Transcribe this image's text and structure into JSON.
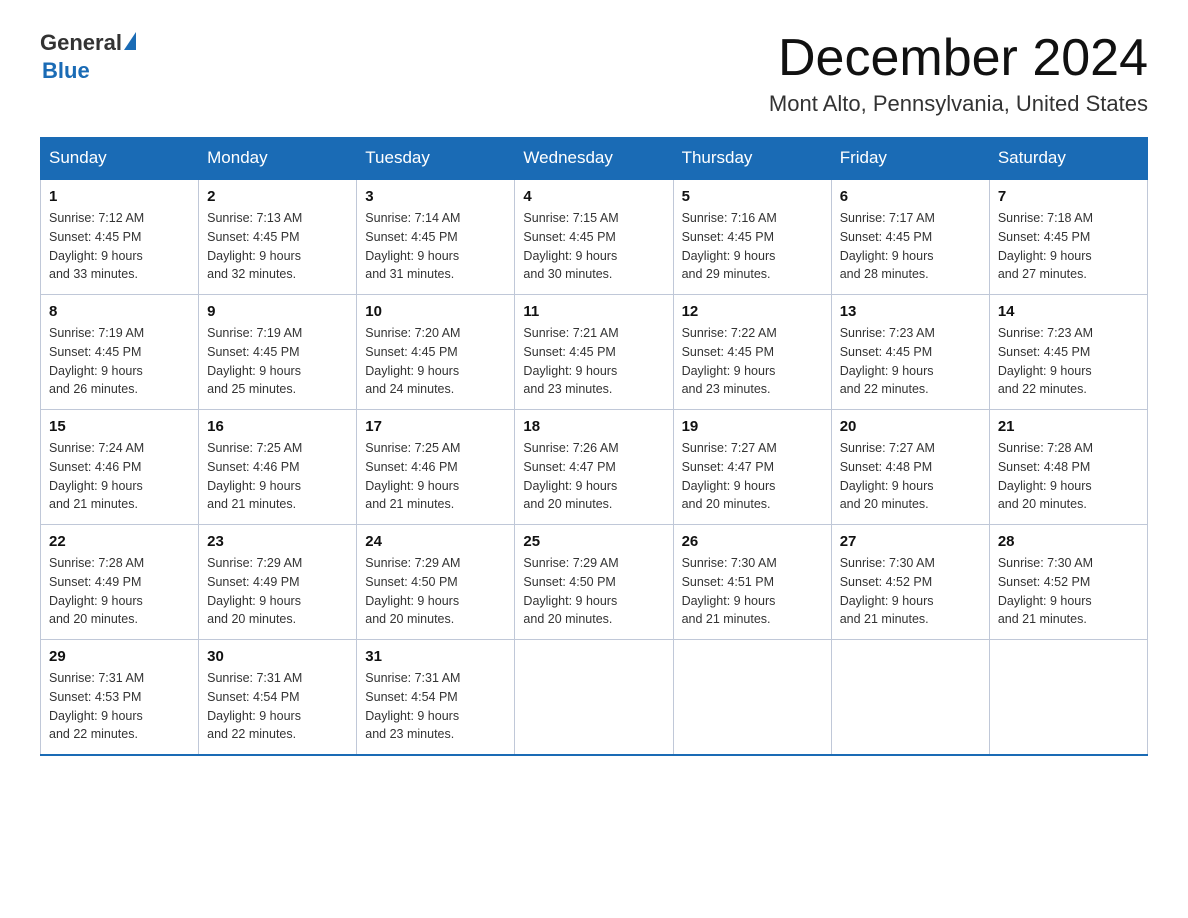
{
  "header": {
    "logo_general": "General",
    "logo_blue": "Blue",
    "month_title": "December 2024",
    "location": "Mont Alto, Pennsylvania, United States"
  },
  "days_of_week": [
    "Sunday",
    "Monday",
    "Tuesday",
    "Wednesday",
    "Thursday",
    "Friday",
    "Saturday"
  ],
  "weeks": [
    [
      {
        "day": "1",
        "sunrise": "7:12 AM",
        "sunset": "4:45 PM",
        "daylight": "9 hours and 33 minutes."
      },
      {
        "day": "2",
        "sunrise": "7:13 AM",
        "sunset": "4:45 PM",
        "daylight": "9 hours and 32 minutes."
      },
      {
        "day": "3",
        "sunrise": "7:14 AM",
        "sunset": "4:45 PM",
        "daylight": "9 hours and 31 minutes."
      },
      {
        "day": "4",
        "sunrise": "7:15 AM",
        "sunset": "4:45 PM",
        "daylight": "9 hours and 30 minutes."
      },
      {
        "day": "5",
        "sunrise": "7:16 AM",
        "sunset": "4:45 PM",
        "daylight": "9 hours and 29 minutes."
      },
      {
        "day": "6",
        "sunrise": "7:17 AM",
        "sunset": "4:45 PM",
        "daylight": "9 hours and 28 minutes."
      },
      {
        "day": "7",
        "sunrise": "7:18 AM",
        "sunset": "4:45 PM",
        "daylight": "9 hours and 27 minutes."
      }
    ],
    [
      {
        "day": "8",
        "sunrise": "7:19 AM",
        "sunset": "4:45 PM",
        "daylight": "9 hours and 26 minutes."
      },
      {
        "day": "9",
        "sunrise": "7:19 AM",
        "sunset": "4:45 PM",
        "daylight": "9 hours and 25 minutes."
      },
      {
        "day": "10",
        "sunrise": "7:20 AM",
        "sunset": "4:45 PM",
        "daylight": "9 hours and 24 minutes."
      },
      {
        "day": "11",
        "sunrise": "7:21 AM",
        "sunset": "4:45 PM",
        "daylight": "9 hours and 23 minutes."
      },
      {
        "day": "12",
        "sunrise": "7:22 AM",
        "sunset": "4:45 PM",
        "daylight": "9 hours and 23 minutes."
      },
      {
        "day": "13",
        "sunrise": "7:23 AM",
        "sunset": "4:45 PM",
        "daylight": "9 hours and 22 minutes."
      },
      {
        "day": "14",
        "sunrise": "7:23 AM",
        "sunset": "4:45 PM",
        "daylight": "9 hours and 22 minutes."
      }
    ],
    [
      {
        "day": "15",
        "sunrise": "7:24 AM",
        "sunset": "4:46 PM",
        "daylight": "9 hours and 21 minutes."
      },
      {
        "day": "16",
        "sunrise": "7:25 AM",
        "sunset": "4:46 PM",
        "daylight": "9 hours and 21 minutes."
      },
      {
        "day": "17",
        "sunrise": "7:25 AM",
        "sunset": "4:46 PM",
        "daylight": "9 hours and 21 minutes."
      },
      {
        "day": "18",
        "sunrise": "7:26 AM",
        "sunset": "4:47 PM",
        "daylight": "9 hours and 20 minutes."
      },
      {
        "day": "19",
        "sunrise": "7:27 AM",
        "sunset": "4:47 PM",
        "daylight": "9 hours and 20 minutes."
      },
      {
        "day": "20",
        "sunrise": "7:27 AM",
        "sunset": "4:48 PM",
        "daylight": "9 hours and 20 minutes."
      },
      {
        "day": "21",
        "sunrise": "7:28 AM",
        "sunset": "4:48 PM",
        "daylight": "9 hours and 20 minutes."
      }
    ],
    [
      {
        "day": "22",
        "sunrise": "7:28 AM",
        "sunset": "4:49 PM",
        "daylight": "9 hours and 20 minutes."
      },
      {
        "day": "23",
        "sunrise": "7:29 AM",
        "sunset": "4:49 PM",
        "daylight": "9 hours and 20 minutes."
      },
      {
        "day": "24",
        "sunrise": "7:29 AM",
        "sunset": "4:50 PM",
        "daylight": "9 hours and 20 minutes."
      },
      {
        "day": "25",
        "sunrise": "7:29 AM",
        "sunset": "4:50 PM",
        "daylight": "9 hours and 20 minutes."
      },
      {
        "day": "26",
        "sunrise": "7:30 AM",
        "sunset": "4:51 PM",
        "daylight": "9 hours and 21 minutes."
      },
      {
        "day": "27",
        "sunrise": "7:30 AM",
        "sunset": "4:52 PM",
        "daylight": "9 hours and 21 minutes."
      },
      {
        "day": "28",
        "sunrise": "7:30 AM",
        "sunset": "4:52 PM",
        "daylight": "9 hours and 21 minutes."
      }
    ],
    [
      {
        "day": "29",
        "sunrise": "7:31 AM",
        "sunset": "4:53 PM",
        "daylight": "9 hours and 22 minutes."
      },
      {
        "day": "30",
        "sunrise": "7:31 AM",
        "sunset": "4:54 PM",
        "daylight": "9 hours and 22 minutes."
      },
      {
        "day": "31",
        "sunrise": "7:31 AM",
        "sunset": "4:54 PM",
        "daylight": "9 hours and 23 minutes."
      },
      null,
      null,
      null,
      null
    ]
  ],
  "labels": {
    "sunrise": "Sunrise:",
    "sunset": "Sunset:",
    "daylight": "Daylight:"
  }
}
